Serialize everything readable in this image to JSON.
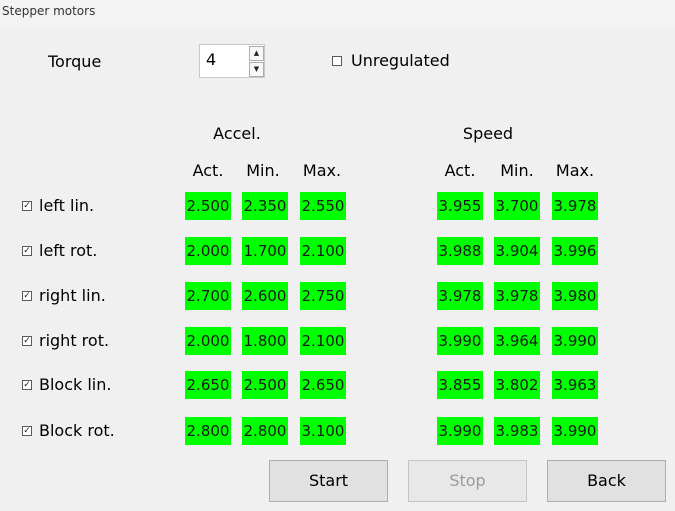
{
  "window": {
    "title": "Stepper motors"
  },
  "torque": {
    "label": "Torque",
    "value": "4",
    "up_glyph": "▲",
    "down_glyph": "▼"
  },
  "unregulated": {
    "label": "Unregulated",
    "checked": false
  },
  "headers": {
    "accel": "Accel.",
    "speed": "Speed",
    "accel_cols": [
      "Act.",
      "Min.",
      "Max."
    ],
    "speed_cols": [
      "Act.",
      "Min.",
      "Max."
    ]
  },
  "check_glyph": "✓",
  "rows": [
    {
      "label": "left lin.",
      "checked": true,
      "accel": [
        "2.500",
        "2.350",
        "2.550"
      ],
      "speed": [
        "3.955",
        "3.700",
        "3.978"
      ]
    },
    {
      "label": "left rot.",
      "checked": true,
      "accel": [
        "2.000",
        "1.700",
        "2.100"
      ],
      "speed": [
        "3.988",
        "3.904",
        "3.996"
      ]
    },
    {
      "label": "right lin.",
      "checked": true,
      "accel": [
        "2.700",
        "2.600",
        "2.750"
      ],
      "speed": [
        "3.978",
        "3.978",
        "3.980"
      ]
    },
    {
      "label": "right rot.",
      "checked": true,
      "accel": [
        "2.000",
        "1.800",
        "2.100"
      ],
      "speed": [
        "3.990",
        "3.964",
        "3.990"
      ]
    },
    {
      "label": "Block lin.",
      "checked": true,
      "accel": [
        "2.650",
        "2.500",
        "2.650"
      ],
      "speed": [
        "3.855",
        "3.802",
        "3.963"
      ]
    },
    {
      "label": "Block rot.",
      "checked": true,
      "accel": [
        "2.800",
        "2.800",
        "3.100"
      ],
      "speed": [
        "3.990",
        "3.983",
        "3.990"
      ]
    }
  ],
  "buttons": {
    "start": {
      "label": "Start",
      "enabled": true
    },
    "stop": {
      "label": "Stop",
      "enabled": false
    },
    "back": {
      "label": "Back",
      "enabled": true
    }
  },
  "colors": {
    "value_cell_bg": "#00ff00",
    "window_bg": "#f0f0f0"
  }
}
